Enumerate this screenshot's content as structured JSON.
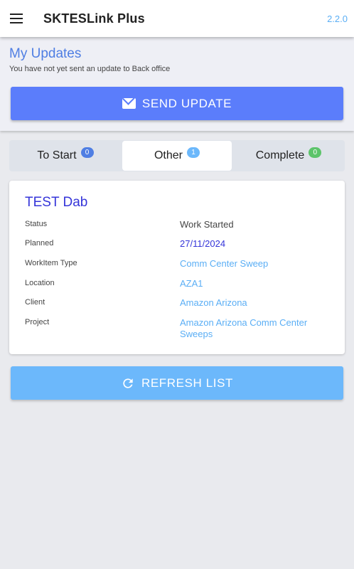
{
  "appbar": {
    "title": "SKTESLink Plus",
    "version": "2.2.0",
    "menu_icon": "hamburger-menu-icon"
  },
  "updates": {
    "title": "My Updates",
    "subtitle": "You have not yet sent an update to Back office",
    "send_label": "SEND UPDATE",
    "send_icon": "envelope-icon"
  },
  "tabs": [
    {
      "label": "To Start",
      "count": "0",
      "badge_color": "#4f7ee3"
    },
    {
      "label": "Other",
      "count": "1",
      "badge_color": "#6cb8fb"
    },
    {
      "label": "Complete",
      "count": "0",
      "badge_color": "#5cc46a"
    }
  ],
  "selected_tab": "Other",
  "card": {
    "title": "TEST Dab",
    "rows": [
      {
        "label": "Status",
        "value": "Work Started"
      },
      {
        "label": "Planned",
        "value": "27/11/2024"
      },
      {
        "label": "WorkItem Type",
        "value": "Comm Center Sweep"
      },
      {
        "label": "Location",
        "value": "AZA1"
      },
      {
        "label": "Client",
        "value": "Amazon Arizona"
      },
      {
        "label": "Project",
        "value": "Amazon Arizona Comm Center Sweeps"
      }
    ]
  },
  "refresh": {
    "label": "REFRESH LIST",
    "icon": "refresh-icon"
  },
  "colors": {
    "primary": "#5b7dfb",
    "accent_light": "#6cb8fb",
    "link": "#5aaef5",
    "title_blue": "#3535d9"
  }
}
